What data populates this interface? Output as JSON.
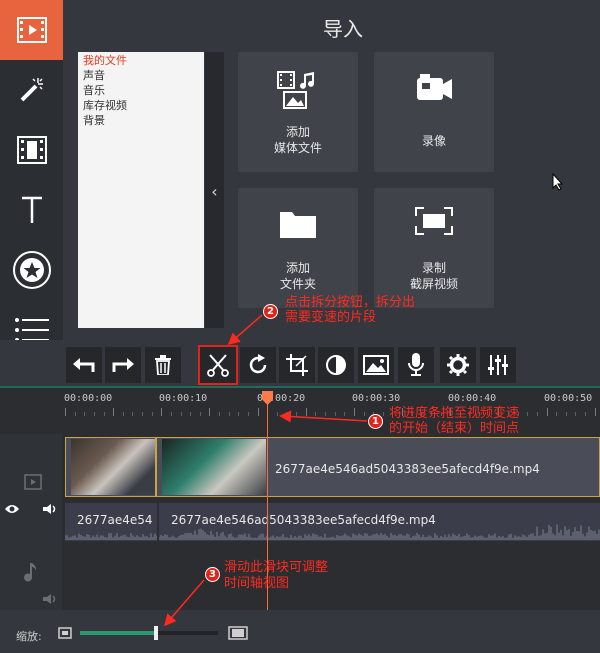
{
  "sidebar": {
    "items": [
      {
        "icon": "video-import-icon",
        "active": true
      },
      {
        "icon": "magic-wand-icon",
        "active": false
      },
      {
        "icon": "film-transitions-icon",
        "active": false
      },
      {
        "icon": "text-icon",
        "active": false
      },
      {
        "icon": "star-sticker-icon",
        "active": false
      },
      {
        "icon": "list-menu-icon",
        "active": false
      }
    ]
  },
  "import_panel": {
    "title": "导入",
    "tree": [
      "我的文件",
      "声音",
      "音乐",
      "库存视频",
      "背景"
    ],
    "tiles": [
      {
        "icon": "media-files-icon",
        "label_line1": "添加",
        "label_line2": "媒体文件"
      },
      {
        "icon": "camera-icon",
        "label_line1": "录像",
        "label_line2": ""
      },
      {
        "icon": "folder-icon",
        "label_line1": "添加",
        "label_line2": "文件夹"
      },
      {
        "icon": "screen-capture-icon",
        "label_line1": "录制",
        "label_line2": "截屏视频"
      }
    ]
  },
  "annotations": {
    "n1": "1",
    "n2": "2",
    "n3": "3",
    "note2_line1": "点击拆分按钮，拆分出",
    "note2_line2": "需要变速的片段",
    "note1_line1": "将进度条拖至视频变速",
    "note1_line2": "的开始（结束）时间点",
    "note3_line1": "滑动此滑块可调整",
    "note3_line2": "时间轴视图"
  },
  "toolbar": {
    "tools": [
      "undo-icon",
      "redo-icon",
      "delete-icon",
      "split-scissors-icon",
      "rotate-icon",
      "crop-icon",
      "color-adjust-icon",
      "picture-icon",
      "microphone-icon",
      "settings-gear-icon",
      "equalizer-icon"
    ]
  },
  "timeline": {
    "ticks": [
      "00:00:00",
      "00:00:10",
      "00:00:20",
      "00:00:30",
      "00:00:40",
      "00:00:50"
    ],
    "video_clip_name": "2677ae4e546ad5043383ee5afecd4f9e.mp4",
    "audio_clip_1_name": "2677ae4e54",
    "audio_clip_2_name": "2677ae4e546ad5043383ee5afecd4f9e.mp4"
  },
  "zoom": {
    "label": "缩放:",
    "level": 0.55
  },
  "colors": {
    "accent": "#e8643f",
    "annotation": "#ff2a1e",
    "playhead": "#ff6a3a",
    "zoom_fill": "#2a9a6e"
  }
}
